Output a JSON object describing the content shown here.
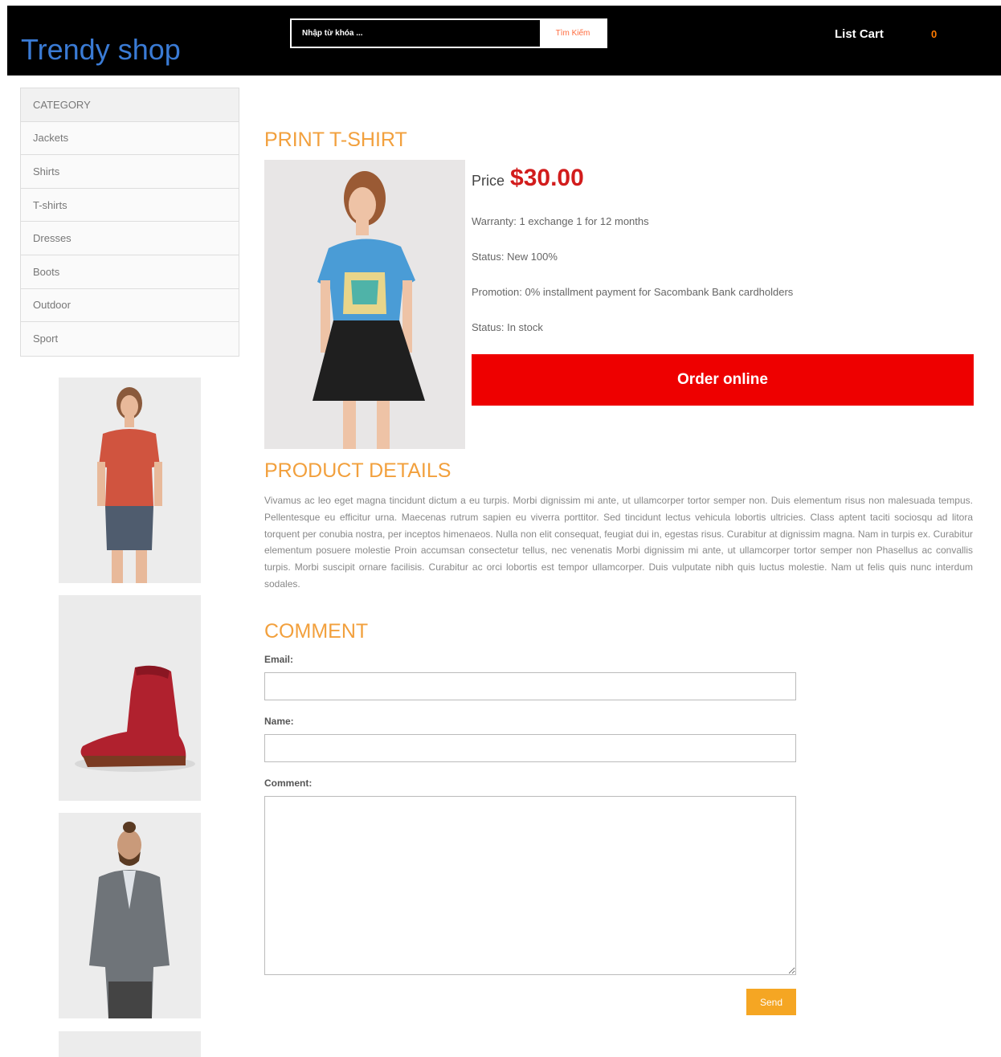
{
  "header": {
    "logo": "Trendy shop",
    "search_placeholder": "Nhập từ khóa ...",
    "search_button": "Tìm Kiếm",
    "list_cart": "List Cart",
    "cart_count": "0"
  },
  "sidebar": {
    "category_title": "CATEGORY",
    "items": [
      {
        "label": "Jackets"
      },
      {
        "label": "Shirts"
      },
      {
        "label": "T-shirts"
      },
      {
        "label": "Dresses"
      },
      {
        "label": "Boots"
      },
      {
        "label": "Outdoor"
      },
      {
        "label": "Sport"
      }
    ]
  },
  "product": {
    "title": "PRINT T-SHIRT",
    "price_label": "Price",
    "price": "$30.00",
    "warranty": "Warranty: 1 exchange 1 for 12 months",
    "status_condition": "Status: New 100%",
    "promotion": "Promotion: 0% installment payment for Sacombank Bank cardholders",
    "status_stock": "Status: In stock",
    "order_button": "Order online"
  },
  "details": {
    "title": "PRODUCT DETAILS",
    "text": "Vivamus ac leo eget magna tincidunt dictum a eu turpis. Morbi dignissim mi ante, ut ullamcorper tortor semper non. Duis elementum risus non malesuada tempus. Pellentesque eu efficitur urna. Maecenas rutrum sapien eu viverra porttitor. Sed tincidunt lectus vehicula lobortis ultricies. Class aptent taciti sociosqu ad litora torquent per conubia nostra, per inceptos himenaeos. Nulla non elit consequat, feugiat dui in, egestas risus. Curabitur at dignissim magna. Nam in turpis ex. Curabitur elementum posuere molestie Proin accumsan consectetur tellus, nec venenatis Morbi dignissim mi ante, ut ullamcorper tortor semper non Phasellus ac convallis turpis. Morbi suscipit ornare facilisis. Curabitur ac orci lobortis est tempor ullamcorper. Duis vulputate nibh quis luctus molestie. Nam ut felis quis nunc interdum sodales."
  },
  "comment": {
    "title": "COMMENT",
    "email_label": "Email:",
    "name_label": "Name:",
    "comment_label": "Comment:",
    "send_button": "Send"
  },
  "colors": {
    "accent_orange": "#f2a03d",
    "price_red": "#d21c1c",
    "order_red": "#ee0000",
    "logo_blue": "#3a7bd5"
  }
}
